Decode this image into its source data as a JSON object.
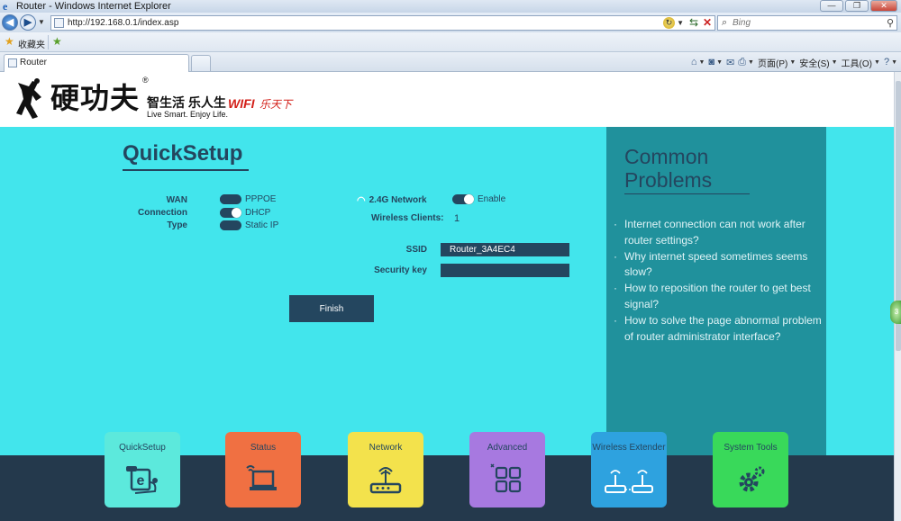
{
  "window": {
    "title": "Router - Windows Internet Explorer",
    "buttons": [
      "—",
      "❐",
      "✕"
    ]
  },
  "address_bar": {
    "url": "http://192.168.0.1/index.asp"
  },
  "search_bar": {
    "placeholder": "Bing"
  },
  "favorites_bar": {
    "label": "收藏夹"
  },
  "tab": {
    "label": "Router"
  },
  "command_bar": {
    "page": "页面(P)",
    "safety": "安全(S)",
    "tools": "工具(O)",
    "help": "?"
  },
  "logo": {
    "cn_name": "硬功夫",
    "reg_mark": "®",
    "slogan_cn": "智生活  乐人生",
    "slogan_en": "Live Smart. Enjoy Life.",
    "wifi": "WIFI",
    "wifi_tail": "乐天下"
  },
  "quicksetup": {
    "title": "QuickSetup",
    "wan_label_lines": [
      "WAN",
      "Connection",
      "Type"
    ],
    "wan_options": [
      {
        "label": "PPPOE",
        "selected": false
      },
      {
        "label": "DHCP",
        "selected": true
      },
      {
        "label": "Static IP",
        "selected": false
      }
    ],
    "network_label": "2.4G Network",
    "enable_label": "Enable",
    "clients_label": "Wireless Clients:",
    "clients_value": "1",
    "ssid_label": "SSID",
    "ssid_value": "Router_3A4EC4",
    "key_label": "Security key",
    "key_value": "",
    "finish_label": "Finish"
  },
  "common_problems": {
    "title": "Common Problems",
    "items": [
      "Internet connection can not work after router settings?",
      "Why internet speed sometimes seems slow?",
      "How to reposition the router to get best signal?",
      "How to solve the page abnormal problem of router administrator interface?"
    ]
  },
  "tiles": [
    {
      "label": "QuickSetup",
      "icon": "quicksetup-e-icon",
      "color": "#5ce9dc"
    },
    {
      "label": "Status",
      "icon": "laptop-status-icon",
      "color": "#f07042"
    },
    {
      "label": "Network",
      "icon": "router-network-icon",
      "color": "#f3e24c"
    },
    {
      "label": "Advanced",
      "icon": "grid-advanced-icon",
      "color": "#a779e0"
    },
    {
      "label": "Wireless Extender",
      "icon": "extender-icon",
      "color": "#2ea2df"
    },
    {
      "label": "System Tools",
      "icon": "gear-icon",
      "color": "#39d95a"
    }
  ],
  "colors": {
    "cyan": "#42e5ec",
    "teal_panel": "#20919c",
    "navy": "#24465f",
    "footer": "#24394c"
  }
}
